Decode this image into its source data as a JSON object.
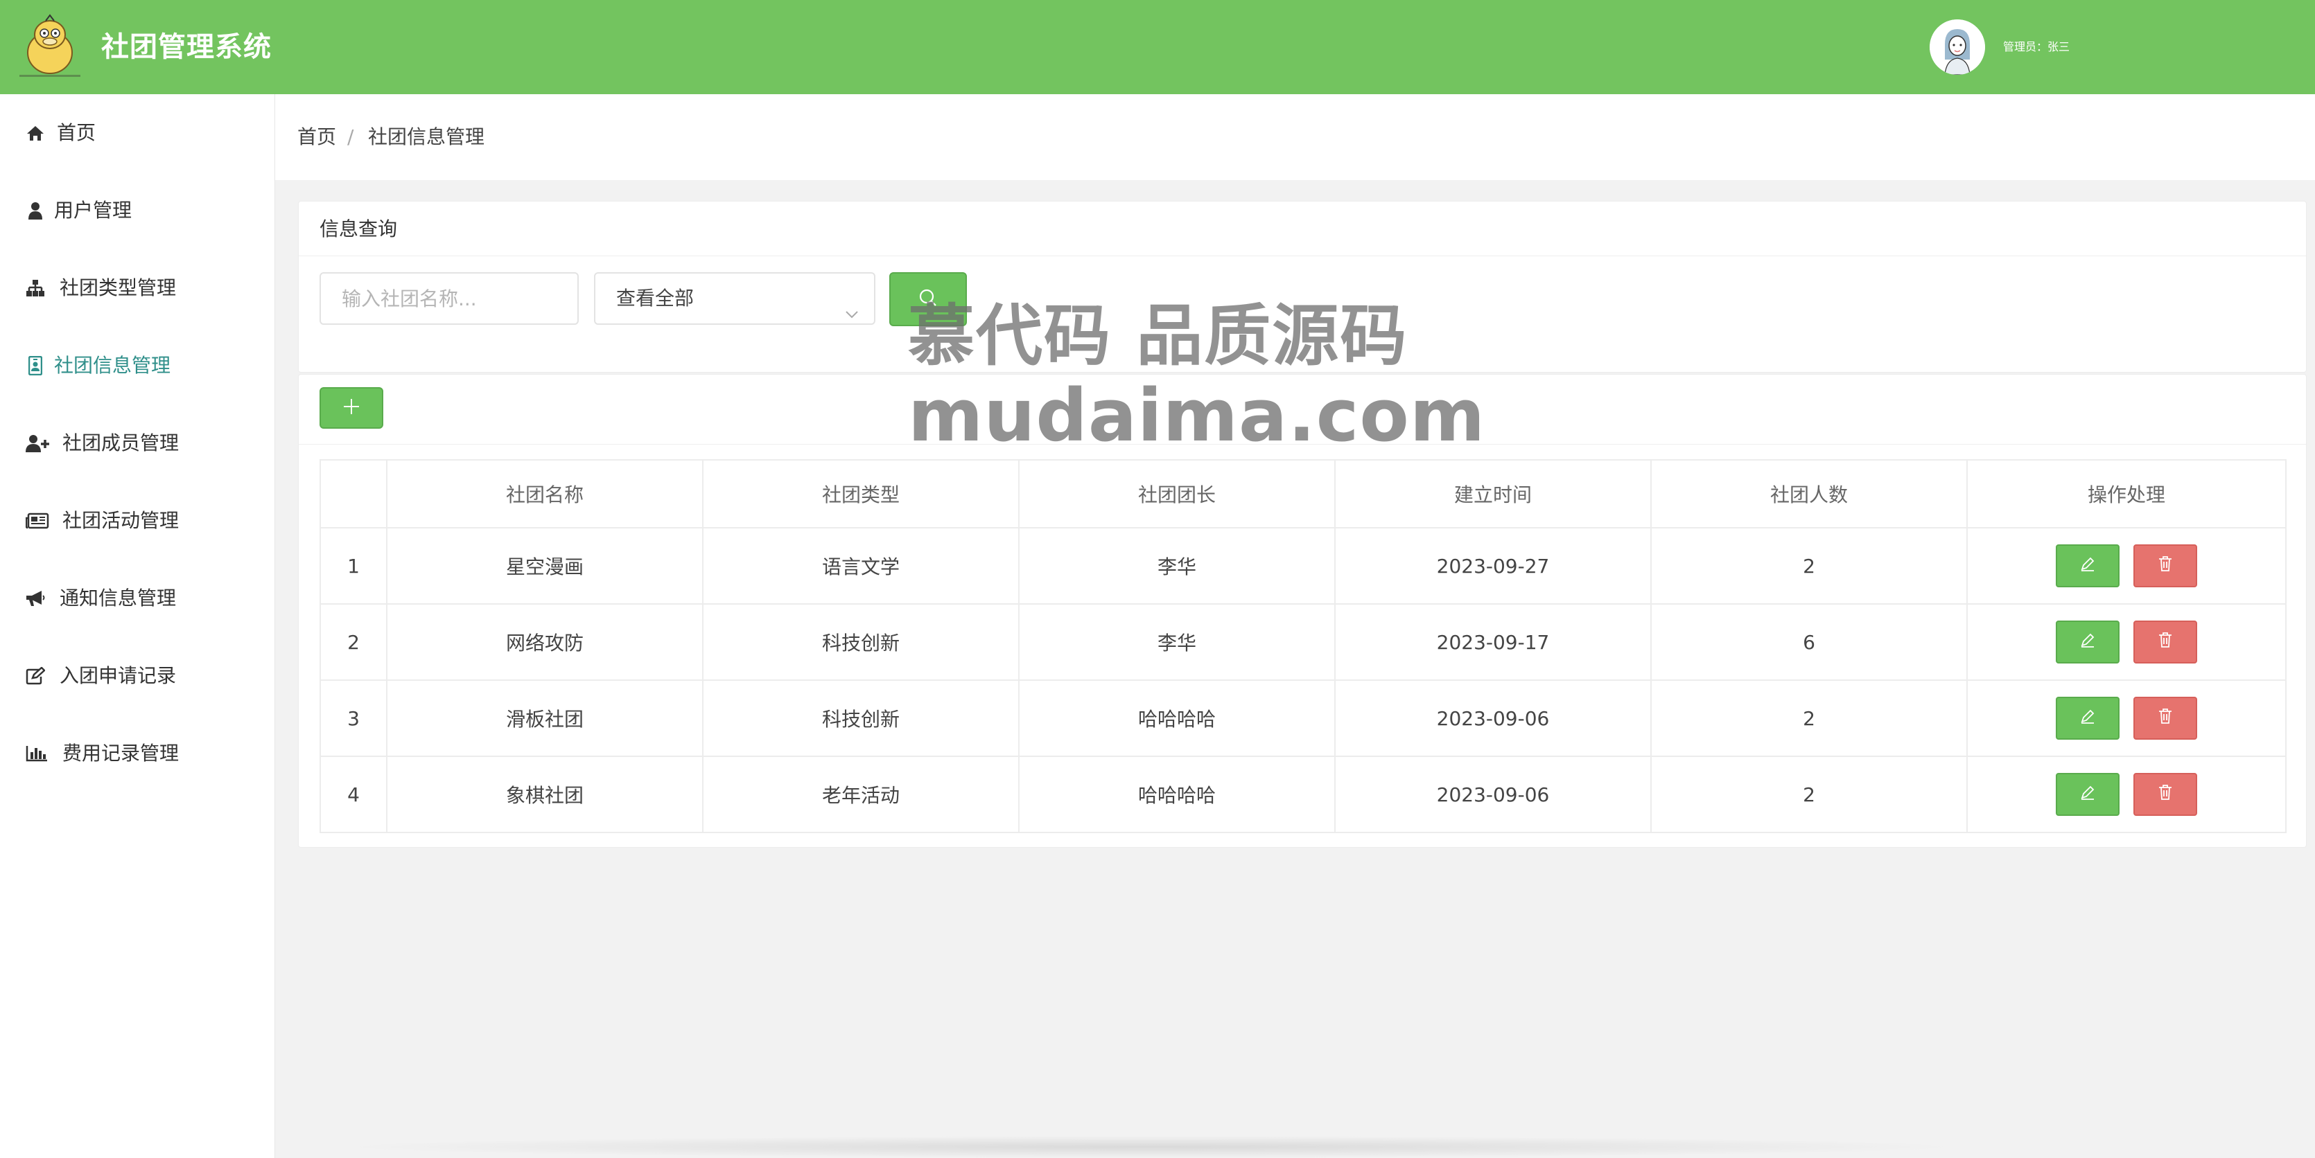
{
  "header": {
    "app_title": "社团管理系统",
    "admin_label": "管理员：张三"
  },
  "sidebar": {
    "items": [
      {
        "label": "首页",
        "icon": "home-icon"
      },
      {
        "label": "用户管理",
        "icon": "user-icon"
      },
      {
        "label": "社团类型管理",
        "icon": "sitemap-icon"
      },
      {
        "label": "社团信息管理",
        "icon": "id-badge-icon",
        "active": true
      },
      {
        "label": "社团成员管理",
        "icon": "user-plus-icon"
      },
      {
        "label": "社团活动管理",
        "icon": "newspaper-icon"
      },
      {
        "label": "通知信息管理",
        "icon": "bullhorn-icon"
      },
      {
        "label": "入团申请记录",
        "icon": "edit-icon"
      },
      {
        "label": "费用记录管理",
        "icon": "bar-chart-icon"
      }
    ]
  },
  "breadcrumb": {
    "home": "首页",
    "separator": "/",
    "current": "社团信息管理"
  },
  "query": {
    "title": "信息查询",
    "search_placeholder": "输入社团名称...",
    "type_select_value": "查看全部"
  },
  "table": {
    "columns": [
      "",
      "社团名称",
      "社团类型",
      "社团团长",
      "建立时间",
      "社团人数",
      "操作处理"
    ],
    "rows": [
      {
        "index": "1",
        "name": "星空漫画",
        "type": "语言文学",
        "leader": "李华",
        "created": "2023-09-27",
        "members": "2"
      },
      {
        "index": "2",
        "name": "网络攻防",
        "type": "科技创新",
        "leader": "李华",
        "created": "2023-09-17",
        "members": "6"
      },
      {
        "index": "3",
        "name": "滑板社团",
        "type": "科技创新",
        "leader": "哈哈哈哈",
        "created": "2023-09-06",
        "members": "2"
      },
      {
        "index": "4",
        "name": "象棋社团",
        "type": "老年活动",
        "leader": "哈哈哈哈",
        "created": "2023-09-06",
        "members": "2"
      }
    ]
  },
  "watermark": {
    "line1": "慕代码 品质源码",
    "line2": "mudaima.com"
  },
  "colors": {
    "brand_green": "#73c45f",
    "button_green": "#6ac25b",
    "danger_red": "#e6736e",
    "active_teal": "#2f8f8a"
  }
}
